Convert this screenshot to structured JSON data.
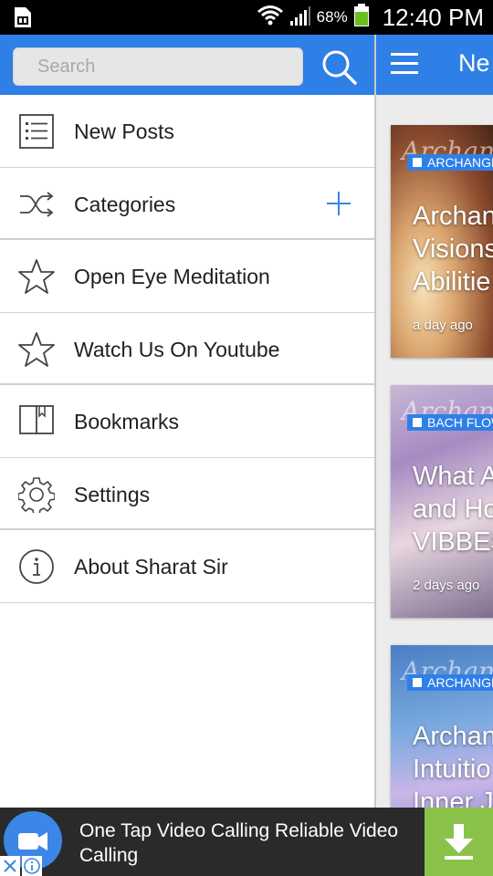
{
  "status_bar": {
    "battery_percent": "68%",
    "time": "12:40 PM"
  },
  "drawer": {
    "search": {
      "placeholder": "Search"
    },
    "menu": [
      {
        "label": "New Posts",
        "icon": "list-icon"
      },
      {
        "label": "Categories",
        "icon": "shuffle-icon",
        "action_icon": "plus-icon"
      },
      {
        "label": "Open Eye Meditation",
        "icon": "star-icon"
      },
      {
        "label": "Watch Us On Youtube",
        "icon": "star-icon"
      },
      {
        "label": "Bookmarks",
        "icon": "book-icon"
      },
      {
        "label": "Settings",
        "icon": "gear-icon"
      },
      {
        "label": "About Sharat Sir",
        "icon": "info-icon"
      }
    ]
  },
  "main": {
    "title": "Ne",
    "cards": [
      {
        "script": "Archange",
        "badge": "ARCHANGE",
        "title": "Archan\nVisions\nAbilitie",
        "time": "a day ago"
      },
      {
        "script": "Archan",
        "badge": "BACH FLOW",
        "title": "What A\nand Ho\nVIBBES",
        "time": "2 days ago"
      },
      {
        "script": "Archan",
        "badge": "ARCHANGE",
        "title": "Archan\nIntuitio\nInner J",
        "time": ""
      }
    ]
  },
  "ad": {
    "text": "One Tap Video Calling Reliable Video Calling"
  },
  "colors": {
    "primary": "#2f80e6",
    "ad_green": "#8bc34a",
    "plus_blue": "#3a86e0"
  }
}
